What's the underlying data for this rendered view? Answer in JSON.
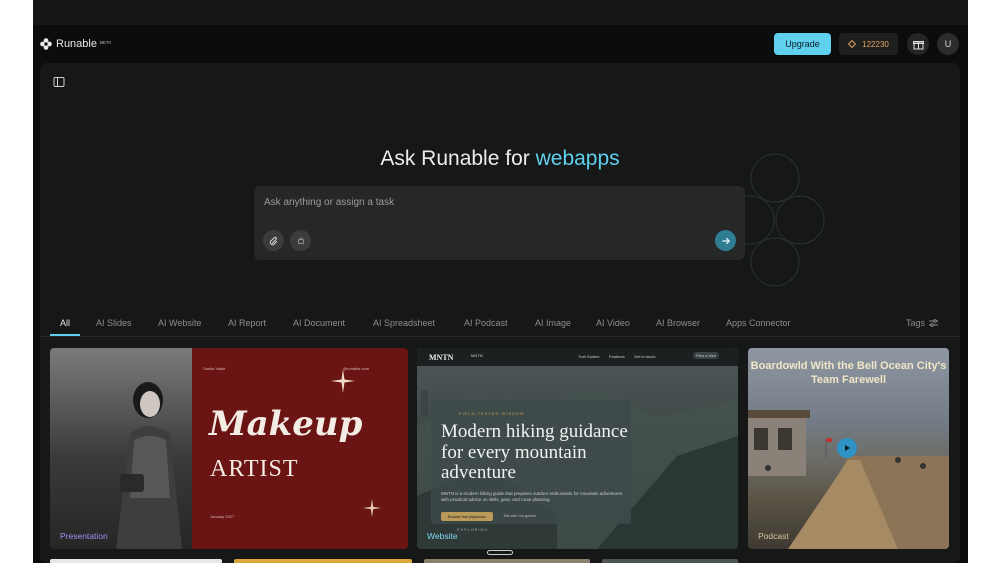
{
  "header": {
    "app_name": "Runable",
    "beta_badge": "BETA",
    "upgrade_label": "Upgrade",
    "credits": "122230",
    "avatar_initial": "U"
  },
  "hero": {
    "headline_prefix": "Ask Runable for",
    "headline_accent": "webapps",
    "prompt_placeholder": "Ask anything or assign a task"
  },
  "tabs": [
    {
      "label": "All",
      "active": true
    },
    {
      "label": "AI Slides"
    },
    {
      "label": "AI Website"
    },
    {
      "label": "AI Report"
    },
    {
      "label": "AI Document"
    },
    {
      "label": "AI Spreadsheet"
    },
    {
      "label": "AI Podcast"
    },
    {
      "label": "AI Image"
    },
    {
      "label": "AI Video"
    },
    {
      "label": "AI Browser"
    },
    {
      "label": "Apps Connector"
    }
  ],
  "tags_label": "Tags",
  "cards": {
    "presentation": {
      "label": "Presentation",
      "small_left": "Sasha Valdé",
      "small_right": "@runable.com",
      "title": "Makeup",
      "subtitle": "ARTIST",
      "date": "January 2027"
    },
    "website": {
      "label": "Website",
      "brand": "MNTN",
      "brand_sub": "MNTN",
      "nav_trail": "Trail Guides",
      "nav_features": "Features",
      "nav_contact": "Get in touch",
      "nav_button": "Plan a hike",
      "kicker": "FIELD-TESTED WISDOM",
      "title": "Modern hiking guidance for every mountain adventure",
      "description": "MNTN is a modern hiking guide that prepares outdoor enthusiasts for mountain adventures with practical advice on skills, gear, and route planning.",
      "cta": "Browse trail playbooks",
      "cta_secondary": "Talk with our guides",
      "explore": "EXPLORING"
    },
    "podcast": {
      "label": "Podcast",
      "title": "Boardowld With the Bell Ocean City's Team Farewell"
    }
  },
  "colors": {
    "accent": "#5fd0ee",
    "credits": "#e0a25c",
    "presentation_label": "#a98bf5",
    "website_label": "#7fd6f0",
    "podcast_label": "#d7c59a"
  },
  "icons": {
    "logo": "runable-logo-icon",
    "sidebar": "sidebar-toggle-icon",
    "credits": "diamond-icon",
    "gift": "gift-icon",
    "attach": "paperclip-icon",
    "connector": "plug-icon",
    "send": "arrow-right-icon",
    "tags": "sliders-icon",
    "play": "play-icon"
  }
}
